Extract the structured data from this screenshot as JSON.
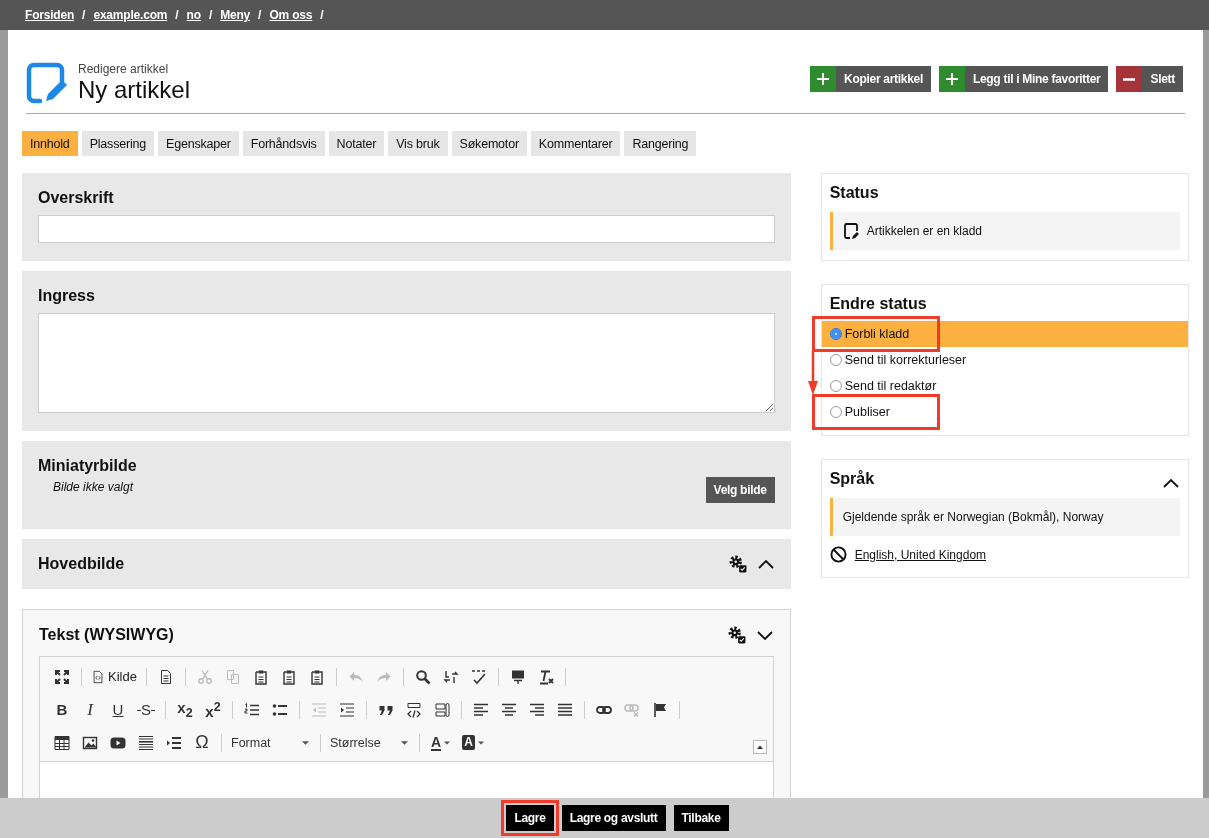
{
  "breadcrumb": [
    {
      "label": "Forsiden",
      "separator": "/"
    },
    {
      "label": "example.com",
      "separator": "/"
    },
    {
      "label": "no",
      "separator": "/"
    },
    {
      "label": "Meny",
      "separator": "/"
    },
    {
      "label": "Om oss",
      "separator": "/"
    }
  ],
  "header": {
    "subtitle": "Redigere artikkel",
    "title": "Ny artikkel"
  },
  "actions": [
    {
      "label": "Kopier artikkel",
      "kind": "add"
    },
    {
      "label": "Legg til i Mine favoritter",
      "kind": "add"
    },
    {
      "label": "Slett",
      "kind": "remove"
    }
  ],
  "tabs": [
    {
      "label": "Innhold",
      "selected": true
    },
    {
      "label": "Plassering",
      "selected": false
    },
    {
      "label": "Egenskaper",
      "selected": false
    },
    {
      "label": "Forhåndsvis",
      "selected": false
    },
    {
      "label": "Notater",
      "selected": false
    },
    {
      "label": "Vis bruk",
      "selected": false
    },
    {
      "label": "Søkemotor",
      "selected": false
    },
    {
      "label": "Kommentarer",
      "selected": false
    },
    {
      "label": "Rangering",
      "selected": false
    }
  ],
  "fields": [
    {
      "kind": "input",
      "label": "Overskrift"
    },
    {
      "kind": "textarea",
      "label": "Ingress"
    },
    {
      "kind": "image",
      "label": "Miniatyrbilde",
      "note": "Bilde ikke valgt",
      "button": "Velg bilde"
    },
    {
      "kind": "section",
      "label": "Hovedbilde",
      "expanded": true
    },
    {
      "kind": "editor",
      "label": "Tekst (WYSIWYG)",
      "expanded": false,
      "toolbar": [
        [
          {
            "kind": "icon",
            "disabled": false
          },
          {
            "kind": "sep"
          },
          {
            "kind": "labeled",
            "label": "Kilde"
          },
          {
            "kind": "sep"
          },
          {
            "kind": "icon",
            "disabled": false
          },
          {
            "kind": "sep"
          },
          {
            "kind": "icon",
            "disabled": true
          },
          {
            "kind": "icon",
            "disabled": true
          },
          {
            "kind": "icon",
            "disabled": false
          },
          {
            "kind": "icon",
            "disabled": false
          },
          {
            "kind": "icon",
            "disabled": false
          },
          {
            "kind": "sep"
          },
          {
            "kind": "icon",
            "disabled": true
          },
          {
            "kind": "icon",
            "disabled": true
          },
          {
            "kind": "sep"
          },
          {
            "kind": "icon",
            "disabled": false
          },
          {
            "kind": "icon",
            "disabled": false
          },
          {
            "kind": "icon",
            "disabled": false
          },
          {
            "kind": "sep"
          },
          {
            "kind": "icon",
            "disabled": false
          },
          {
            "kind": "icon",
            "disabled": false
          },
          {
            "kind": "sep"
          }
        ],
        [
          {
            "kind": "bold",
            "text": "B"
          },
          {
            "kind": "italic",
            "text": "I"
          },
          {
            "kind": "underline",
            "text": "U"
          },
          {
            "kind": "strike",
            "text": "S"
          },
          {
            "kind": "sep"
          },
          {
            "kind": "subscript",
            "text": "x$_{2}$"
          },
          {
            "kind": "superscript",
            "text": "x$^{2}$"
          },
          {
            "kind": "sep"
          },
          {
            "kind": "icon",
            "disabled": false
          },
          {
            "kind": "icon",
            "disabled": false
          },
          {
            "kind": "sep"
          },
          {
            "kind": "icon",
            "disabled": true
          },
          {
            "kind": "icon",
            "disabled": false
          },
          {
            "kind": "sep"
          },
          {
            "kind": "icon",
            "disabled": false
          },
          {
            "kind": "icon",
            "disabled": false
          },
          {
            "kind": "icon",
            "disabled": false
          },
          {
            "kind": "sep"
          },
          {
            "kind": "icon",
            "disabled": false
          },
          {
            "kind": "icon",
            "disabled": false
          },
          {
            "kind": "icon",
            "disabled": false
          },
          {
            "kind": "icon",
            "disabled": false
          },
          {
            "kind": "sep"
          },
          {
            "kind": "icon",
            "disabled": false
          },
          {
            "kind": "icon",
            "disabled": true
          },
          {
            "kind": "icon",
            "disabled": false
          },
          {
            "kind": "sep"
          }
        ],
        [
          {
            "kind": "icon",
            "disabled": false
          },
          {
            "kind": "icon",
            "disabled": false
          },
          {
            "kind": "icon",
            "disabled": false
          },
          {
            "kind": "icon",
            "disabled": false
          },
          {
            "kind": "icon",
            "disabled": false
          },
          {
            "kind": "symbol",
            "text": "Ω"
          },
          {
            "kind": "sep"
          },
          {
            "kind": "dropdown",
            "label": "Format"
          },
          {
            "kind": "sep"
          },
          {
            "kind": "dropdown",
            "label": "Størrelse"
          },
          {
            "kind": "sep"
          },
          {
            "kind": "color",
            "text": "A"
          },
          {
            "kind": "bgcolor",
            "text": "A"
          }
        ]
      ]
    }
  ],
  "status": {
    "title": "Status",
    "message": "Artikkelen er en kladd"
  },
  "change_status": {
    "title": "Endre status",
    "arrow": true,
    "options": [
      {
        "label": "Forbli kladd",
        "selected": true,
        "highlighted": true
      },
      {
        "label": "Send til korrekturleser",
        "selected": false,
        "highlighted": false
      },
      {
        "label": "Send til redaktør",
        "selected": false,
        "highlighted": false
      },
      {
        "label": "Publiser",
        "selected": false,
        "highlighted": true
      }
    ]
  },
  "language": {
    "title": "Språk",
    "expanded": true,
    "current": "Gjeldende språk er Norwegian (Bokmål), Norway",
    "other": "English, United Kingdom"
  },
  "footer": [
    {
      "label": "Lagre",
      "highlighted": true
    },
    {
      "label": "Lagre og avslutt",
      "highlighted": false
    },
    {
      "label": "Tilbake",
      "highlighted": false
    }
  ]
}
